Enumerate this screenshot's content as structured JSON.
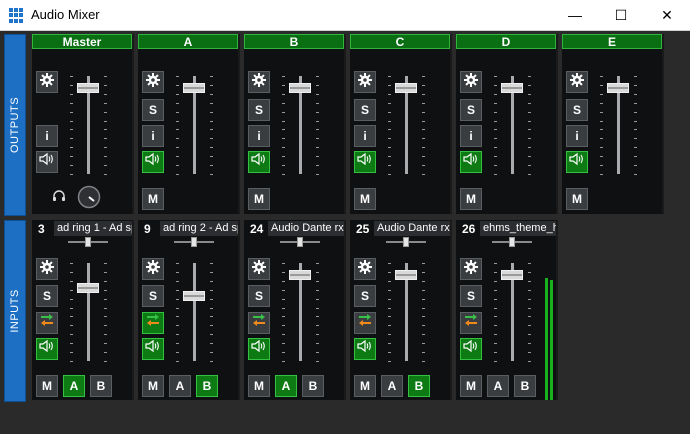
{
  "window": {
    "title": "Audio Mixer",
    "minimize": "—",
    "maximize": "☐",
    "close": "✕"
  },
  "sections": {
    "outputs": "OUTPUTS",
    "inputs": "INPUTS"
  },
  "outputs": [
    {
      "id": "master",
      "name": "Master",
      "has_s": false,
      "speaker_on": false,
      "level": 0.88
    },
    {
      "id": "a",
      "name": "A",
      "has_s": true,
      "speaker_on": true,
      "level": 0.88
    },
    {
      "id": "b",
      "name": "B",
      "has_s": true,
      "speaker_on": true,
      "level": 0.88
    },
    {
      "id": "c",
      "name": "C",
      "has_s": true,
      "speaker_on": true,
      "level": 0.88
    },
    {
      "id": "d",
      "name": "D",
      "has_s": true,
      "speaker_on": true,
      "level": 0.88
    },
    {
      "id": "e",
      "name": "E",
      "has_s": true,
      "speaker_on": true,
      "level": 0.88
    }
  ],
  "inputs": [
    {
      "num": "3",
      "name": "ad ring 1 - Ad sp",
      "pan": 0.5,
      "level": 0.74,
      "a_on": true,
      "b_on": false,
      "routing_on": false,
      "meter": false
    },
    {
      "num": "9",
      "name": "ad ring 2 - Ad sp",
      "pan": 0.5,
      "level": 0.66,
      "a_on": false,
      "b_on": true,
      "routing_on": true,
      "meter": false
    },
    {
      "num": "24",
      "name": "Audio Dante rx",
      "pan": 0.5,
      "level": 0.88,
      "a_on": true,
      "b_on": false,
      "routing_on": false,
      "meter": false
    },
    {
      "num": "25",
      "name": "Audio Dante rx",
      "pan": 0.5,
      "level": 0.88,
      "a_on": false,
      "b_on": true,
      "routing_on": false,
      "meter": false
    },
    {
      "num": "26",
      "name": "ehms_theme_h",
      "pan": 0.5,
      "level": 0.88,
      "a_on": false,
      "b_on": false,
      "routing_on": false,
      "meter": true
    }
  ],
  "labels": {
    "s": "S",
    "i": "i",
    "m": "M",
    "a": "A",
    "b": "B"
  },
  "colors": {
    "accent_blue": "#1d6fc4",
    "active_green": "#0d7a14",
    "routing_orange": "#f08a1c"
  },
  "icons": [
    "gear-icon",
    "speaker-icon",
    "headphones-icon",
    "routing-arrows-icon",
    "monitor-knob"
  ]
}
